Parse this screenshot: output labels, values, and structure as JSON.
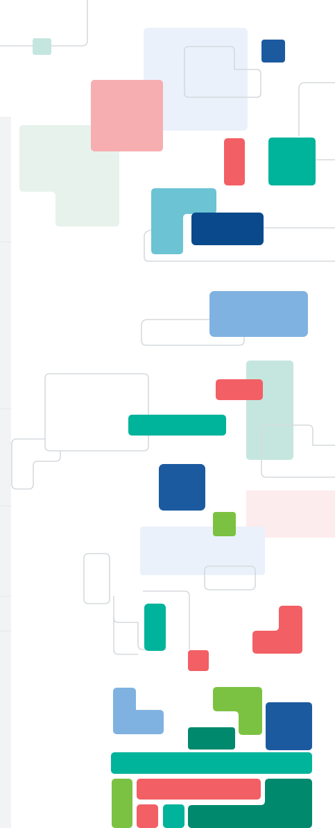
{
  "palette": {
    "navy": "#1c5aa0",
    "dark_navy": "#0a4a8c",
    "teal": "#00b39b",
    "dark_teal": "#00896c",
    "coral": "#f25f65",
    "pink": "#f7aeb1",
    "light_blue": "#7fb2e0",
    "sky": "#6bc3d3",
    "green": "#7cc242",
    "mint": "#c5e6df",
    "pale_mint": "#e7f2ec",
    "pale_blue": "#eaf1fb",
    "pale_pink": "#fdecee",
    "grey_line": "#d6dadd",
    "pale_grey_strip": "#f2f3f4"
  }
}
